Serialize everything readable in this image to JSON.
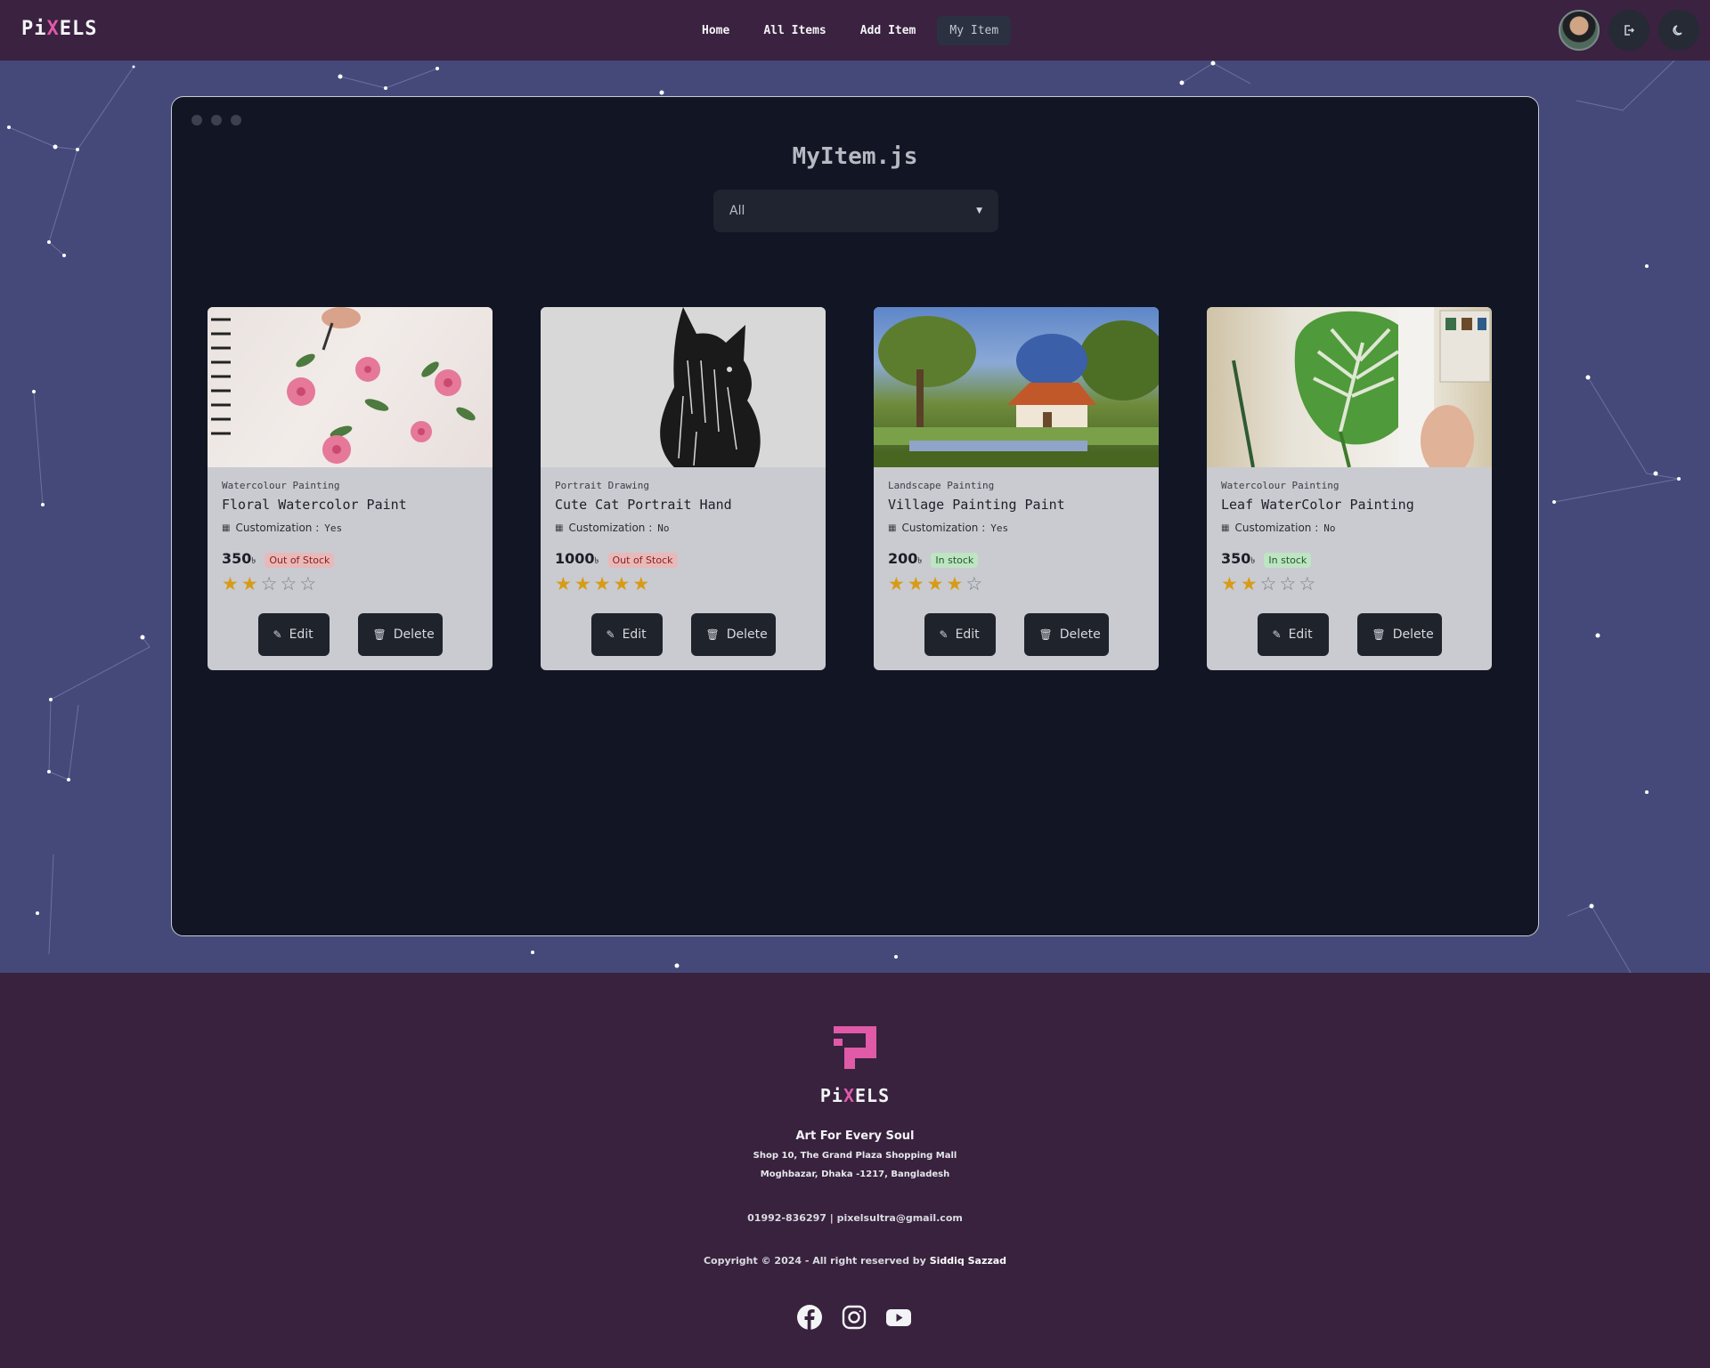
{
  "navbar": {
    "logo": {
      "pre": "Pi",
      "x": "X",
      "post": "ELS"
    },
    "links": [
      {
        "label": "Home"
      },
      {
        "label": "All Items"
      },
      {
        "label": "Add Item"
      },
      {
        "label": "My Item"
      }
    ],
    "active_link": "My Item",
    "icons": [
      "avatar",
      "logout-icon",
      "moon-icon"
    ]
  },
  "window": {
    "title": "MyItem.js",
    "filter": {
      "selected": "All"
    }
  },
  "items": [
    {
      "image_icon": "floral-watercolor-image",
      "category": "Watercolour Painting",
      "name": "Floral Watercolor Paint",
      "customization_label": "Customization :",
      "customization": "Yes",
      "price": "350",
      "currency": "৳",
      "stock": "Out of Stock",
      "rating": 2,
      "edit_label": "Edit",
      "delete_label": "Delete"
    },
    {
      "image_icon": "cat-portrait-image",
      "category": "Portrait Drawing",
      "name": "Cute Cat Portrait Hand",
      "customization_label": "Customization :",
      "customization": "No",
      "price": "1000",
      "currency": "৳",
      "stock": "Out of Stock",
      "rating": 5,
      "edit_label": "Edit",
      "delete_label": "Delete"
    },
    {
      "image_icon": "village-landscape-image",
      "category": "Landscape Painting",
      "name": "Village Painting Paint",
      "customization_label": "Customization :",
      "customization": "Yes",
      "price": "200",
      "currency": "৳",
      "stock": "In stock",
      "rating": 4,
      "edit_label": "Edit",
      "delete_label": "Delete"
    },
    {
      "image_icon": "leaf-watercolor-image",
      "category": "Watercolour Painting",
      "name": "Leaf WaterColor Painting",
      "customization_label": "Customization :",
      "customization": "No",
      "price": "350",
      "currency": "৳",
      "stock": "In stock",
      "rating": 2,
      "edit_label": "Edit",
      "delete_label": "Delete"
    }
  ],
  "footer": {
    "logo": {
      "pre": "Pi",
      "x": "X",
      "post": "ELS"
    },
    "tagline": "Art For Every Soul",
    "address_line1": "Shop 10, The Grand Plaza Shopping Mall",
    "address_line2": "Moghbazar, Dhaka -1217, Bangladesh",
    "contact": "01992-836297 | pixelsultra@gmail.com",
    "copyright": "Copyright © 2024 - All right reserved by",
    "author": "Siddiq Sazzad",
    "socials": [
      "facebook-icon",
      "instagram-icon",
      "youtube-icon"
    ]
  },
  "colors": {
    "brand_pink": "#e05aa8",
    "navbar_bg": "#3a2240",
    "page_bg": "#45497a",
    "window_bg": "#121624",
    "star_gold": "#d89b16"
  }
}
